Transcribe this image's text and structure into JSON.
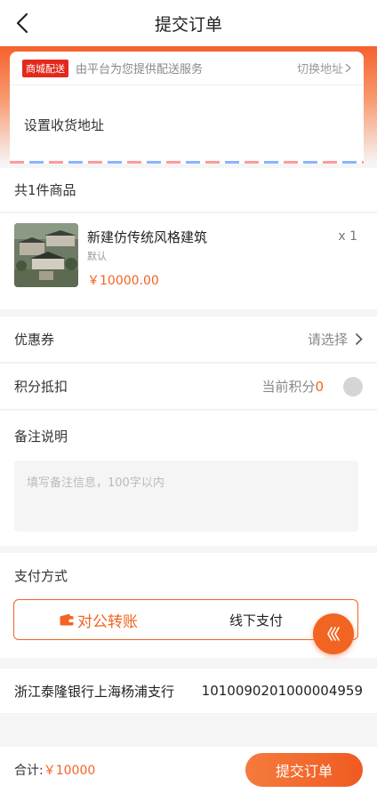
{
  "nav": {
    "title": "提交订单"
  },
  "address": {
    "tag": "商城配送",
    "tag_desc": "由平台为您提供配送服务",
    "switch_label": "切换地址",
    "set_label": "设置收货地址"
  },
  "goods": {
    "count_label": "共1件商品",
    "items": [
      {
        "name": "新建仿传统风格建筑",
        "spec": "默认",
        "price": "￥10000.00",
        "qty": "x 1"
      }
    ]
  },
  "coupon": {
    "label": "优惠券",
    "value": "请选择"
  },
  "points": {
    "label": "积分抵扣",
    "prefix": "当前积分",
    "value": "0"
  },
  "remark": {
    "label": "备注说明",
    "placeholder": "填写备注信息，100字以内",
    "value": ""
  },
  "payment": {
    "label": "支付方式",
    "options": [
      {
        "label": "对公转账",
        "selected": true
      },
      {
        "label": "线下支付",
        "selected": false
      }
    ]
  },
  "bank": {
    "name": "浙江泰隆银行上海杨浦支行",
    "account": "1010090201000004959"
  },
  "footer": {
    "total_label": "合计:",
    "total_value": "￥10000",
    "submit_label": "提交订单"
  },
  "colors": {
    "accent": "#f26422",
    "tag_red": "#e4281d"
  }
}
